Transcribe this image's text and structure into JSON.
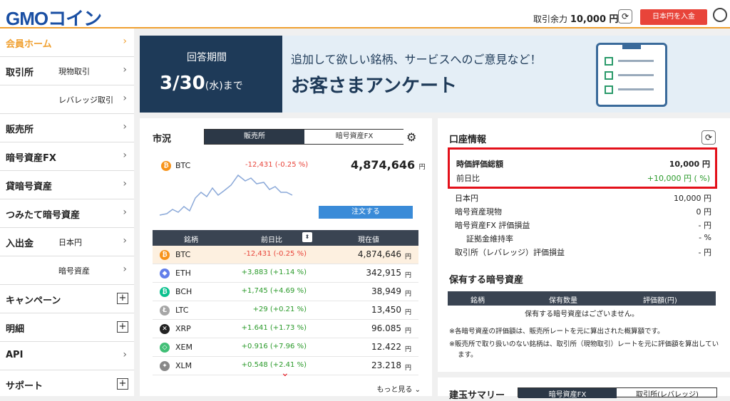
{
  "header": {
    "logo": "GMOコイン",
    "balance_label": "取引余力",
    "balance_value": "10,000 円",
    "deposit_button": "日本円を入金"
  },
  "sidebar": {
    "items": [
      {
        "label": "会員ホーム",
        "sub": "",
        "active": true
      },
      {
        "label": "取引所",
        "sub": "現物取引"
      },
      {
        "label": "",
        "sub": "レバレッジ取引"
      },
      {
        "label": "販売所",
        "sub": ""
      },
      {
        "label": "暗号資産FX",
        "sub": ""
      },
      {
        "label": "貸暗号資産",
        "sub": ""
      },
      {
        "label": "つみたて暗号資産",
        "sub": ""
      },
      {
        "label": "入出金",
        "sub": "日本円"
      },
      {
        "label": "",
        "sub": "暗号資産"
      },
      {
        "label": "キャンペーン",
        "sub": "",
        "plus": true
      },
      {
        "label": "明細",
        "sub": "",
        "plus": true
      },
      {
        "label": "API",
        "sub": ""
      },
      {
        "label": "サポート",
        "sub": "",
        "plus": true
      }
    ]
  },
  "banner": {
    "period_label": "回答期間",
    "date_main": "3/30",
    "date_paren": "(水)",
    "date_suffix": "まで",
    "line1": "追加して欲しい銘柄、サービスへのご意見など！",
    "line2": "お客さまアンケート"
  },
  "market": {
    "title": "市況",
    "tab_active": "販売所",
    "tab_inactive": "暗号資産FX",
    "highlight": {
      "symbol": "BTC",
      "change": "-12,431 (-0.25 %)",
      "price": "4,874,646",
      "unit": "円"
    },
    "order_button": "注文する",
    "columns": [
      "銘柄",
      "前日比",
      "現在値"
    ],
    "rows": [
      {
        "symbol": "BTC",
        "change": "-12,431 (-0.25 %)",
        "price": "4,874,646",
        "neg": true,
        "color": "#f7931a",
        "glyph": "₿"
      },
      {
        "symbol": "ETH",
        "change": "+3,883 (+1.14 %)",
        "price": "342,915",
        "color": "#627eea",
        "glyph": "◆"
      },
      {
        "symbol": "BCH",
        "change": "+1,745 (+4.69 %)",
        "price": "38,949",
        "color": "#0ac18e",
        "glyph": "₿"
      },
      {
        "symbol": "LTC",
        "change": "+29 (+0.21 %)",
        "price": "13,450",
        "color": "#a6a6a6",
        "glyph": "Ł"
      },
      {
        "symbol": "XRP",
        "change": "+1.641 (+1.73 %)",
        "price": "96.085",
        "color": "#222222",
        "glyph": "✕"
      },
      {
        "symbol": "XEM",
        "change": "+0.916 (+7.96 %)",
        "price": "12.422",
        "color": "#41bf76",
        "glyph": "◇"
      },
      {
        "symbol": "XLM",
        "change": "+0.548 (+2.41 %)",
        "price": "23.218",
        "color": "#888888",
        "glyph": "✦"
      }
    ],
    "more_label": "もっと見る"
  },
  "account": {
    "title": "口座情報",
    "total_label": "時価評価総額",
    "total_value": "10,000 円",
    "daychange_label": "前日比",
    "daychange_value": "+10,000 円 ( %)",
    "lines": [
      {
        "label": "日本円",
        "value": "10,000 円"
      },
      {
        "label": "暗号資産現物",
        "value": "0 円"
      },
      {
        "label": "暗号資産FX 評価損益",
        "value": "- 円"
      },
      {
        "label": "証拠金維持率",
        "value": "- %"
      },
      {
        "label": "取引所（レバレッジ）評価損益",
        "value": "- 円"
      }
    ],
    "holdings_title": "保有する暗号資産",
    "holdings_columns": [
      "銘柄",
      "保有数量",
      "評価額(円)"
    ],
    "holdings_empty": "保有する暗号資産はございません。",
    "note1": "※各暗号資産の評価額は、販売所レートを元に算出された概算額です。",
    "note2": "※販売所で取り扱いのない銘柄は、取引所（現物取引）レートを元に評価額を算出しています。"
  },
  "position": {
    "title": "建玉サマリー",
    "tab_active": "暗号資産FX",
    "tab_inactive": "取引所(レバレッジ)"
  }
}
